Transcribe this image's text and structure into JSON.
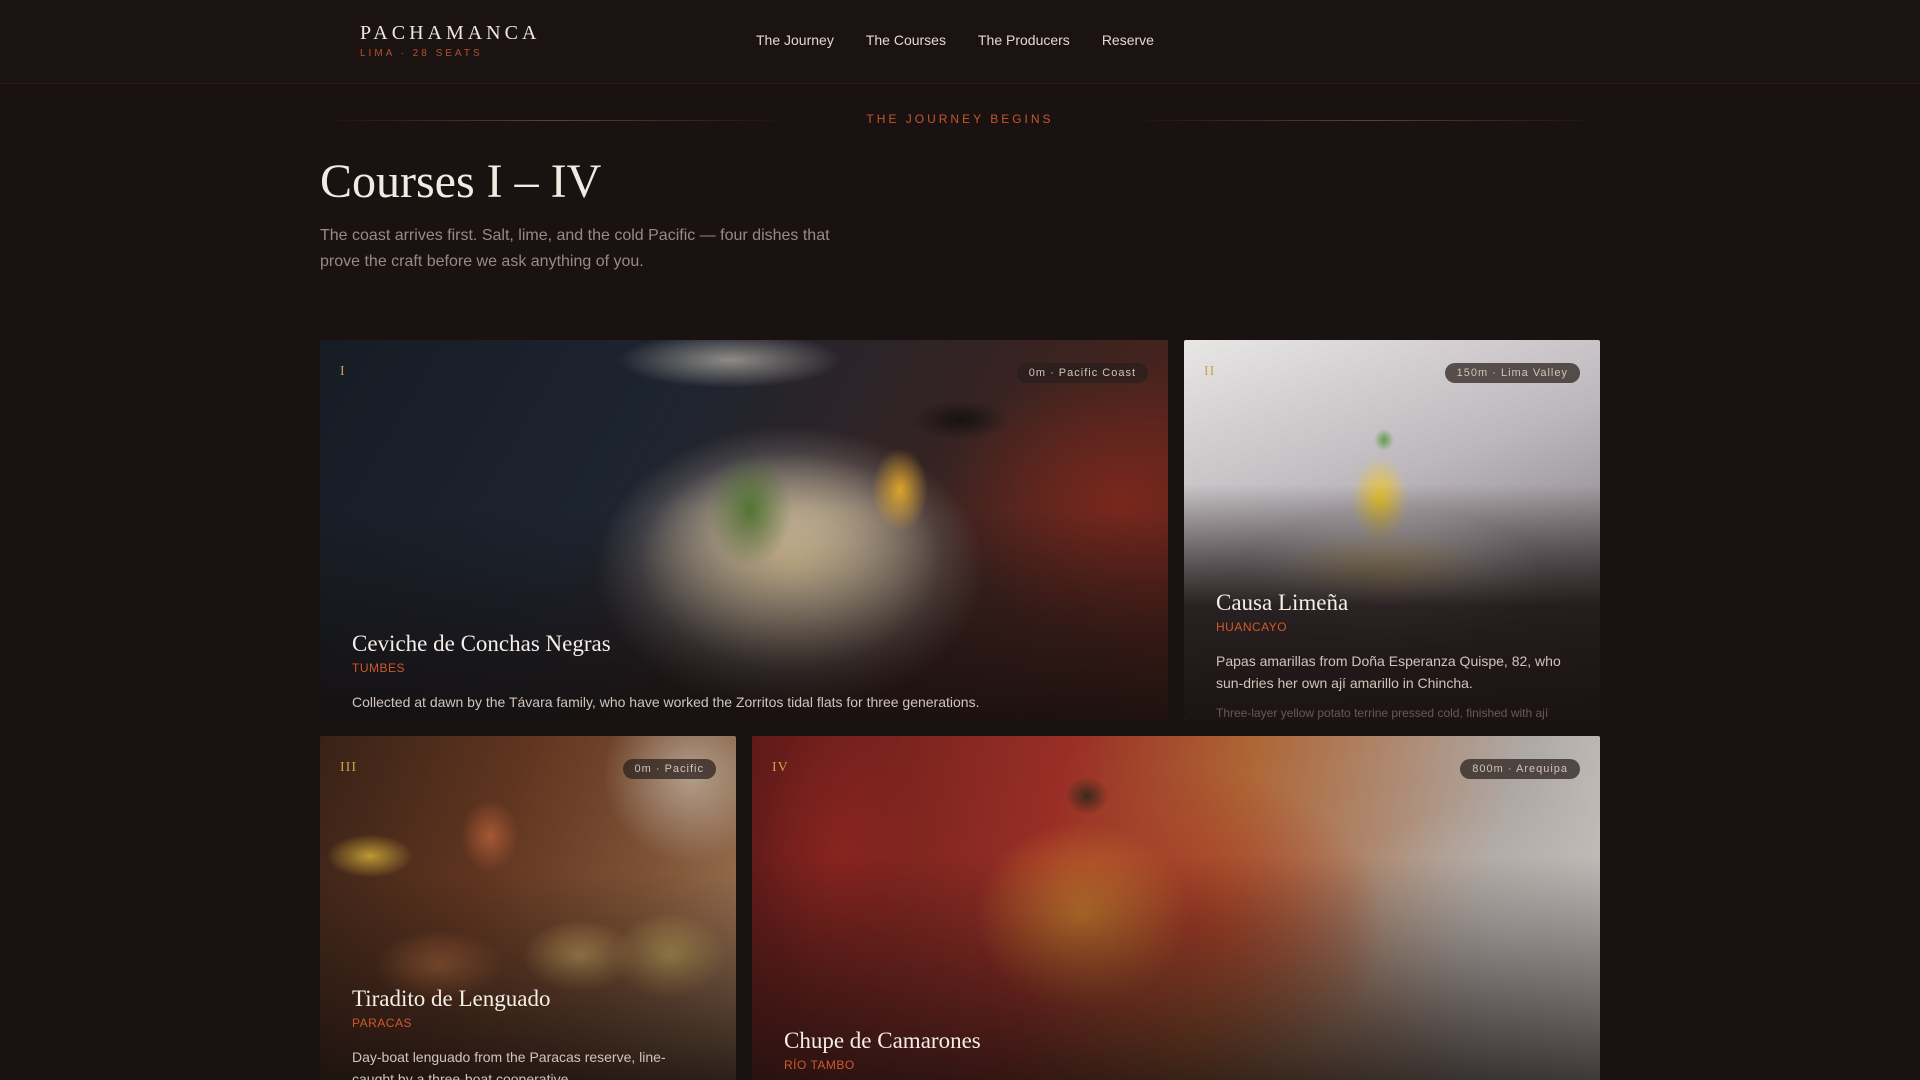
{
  "brand": {
    "name": "PACHAMANCA",
    "sub": "LIMA · 28 SEATS"
  },
  "nav": [
    {
      "label": "The Journey"
    },
    {
      "label": "The Courses"
    },
    {
      "label": "The Producers"
    },
    {
      "label": "Reserve"
    }
  ],
  "intro": {
    "eyebrow": "THE JOURNEY BEGINS",
    "title": "Courses I – IV",
    "lede": "The coast arrives first. Salt, lime, and the cold Pacific — four dishes that prove the craft before we ask anything of you."
  },
  "courses": [
    {
      "numeral": "I",
      "altitude": "0m · Pacific Coast",
      "dish": "Ceviche de Conchas Negras",
      "origin": "TUMBES",
      "note": "Collected at dawn by the Távara family, who have worked the Zorritos tidal flats for three generations.",
      "detail": ""
    },
    {
      "numeral": "II",
      "altitude": "150m · Lima Valley",
      "dish": "Causa Limeña",
      "origin": "HUANCAYO",
      "note": "Papas amarillas from Doña Esperanza Quispe, 82, who sun-dries her own ají amarillo in Chincha.",
      "detail": "Three-layer yellow potato terrine pressed cold, finished with ají"
    },
    {
      "numeral": "III",
      "altitude": "0m · Pacific",
      "dish": "Tiradito de Lenguado",
      "origin": "PARACAS",
      "note": "Day-boat lenguado from the Paracas reserve, line-caught by a three-boat cooperative.",
      "detail": ""
    },
    {
      "numeral": "IV",
      "altitude": "800m · Arequipa",
      "dish": "Chupe de Camarones",
      "origin": "RÍO TAMBO",
      "note": "",
      "detail": ""
    }
  ],
  "colors": {
    "background": "#1a1211",
    "accent": "#c4552d",
    "numeral": "#c9a24d"
  }
}
